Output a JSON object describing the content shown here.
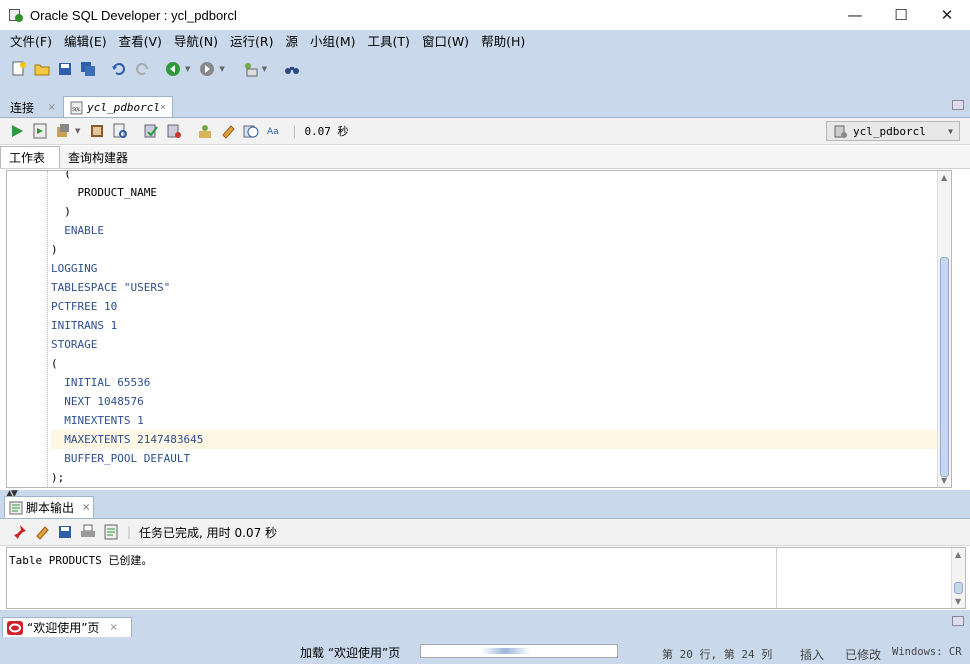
{
  "window": {
    "title": "Oracle SQL Developer : ycl_pdborcl",
    "minimize_label": "—",
    "maximize_label": "☐",
    "close_label": "✕"
  },
  "menu": [
    "文件(F)",
    "编辑(E)",
    "查看(V)",
    "导航(N)",
    "运行(R)",
    "源",
    "小组(M)",
    "工具(T)",
    "窗口(W)",
    "帮助(H)"
  ],
  "doc_tabs": {
    "connections": "连接",
    "connections_close": "×",
    "worksheet": "ycl_pdborcl",
    "worksheet_close": "×"
  },
  "worksheet_toolbar": {
    "elapsed": "0.07 秒",
    "connection": "ycl_pdborcl"
  },
  "sub_tabs": {
    "worksheet": "工作表",
    "query_builder": "查询构建器"
  },
  "code_lines": [
    "  (",
    "    PRODUCT_NAME",
    "  )",
    "  ENABLE",
    ")",
    "LOGGING",
    "TABLESPACE \"USERS\"",
    "PCTFREE 10",
    "INITRANS 1",
    "STORAGE",
    "(",
    "  INITIAL 65536",
    "  NEXT 1048576",
    "  MINEXTENTS 1",
    "  MAXEXTENTS 2147483645",
    "  BUFFER_POOL DEFAULT",
    ");"
  ],
  "output_panel": {
    "tab_label": "脚本输出",
    "tab_close": "×",
    "status_message": "任务已完成, 用时 0.07 秒",
    "output_text": "Table PRODUCTS 已创建。"
  },
  "welcome_tab": {
    "label": "“欢迎使用”页",
    "close": "×"
  },
  "statusbar": {
    "loading": "加载 “欢迎使用”页",
    "loading_progress": 0.25,
    "position": "第 20 行, 第 24 列",
    "insert_mode": "插入",
    "modified": "已修改",
    "line_endings": "Windows: CR"
  },
  "colors": {
    "keyword": "#2d4f8f",
    "number": "#2f8f7a",
    "highlight_line": "#fdf7e3",
    "chrome_bg": "#c9d8ea"
  }
}
